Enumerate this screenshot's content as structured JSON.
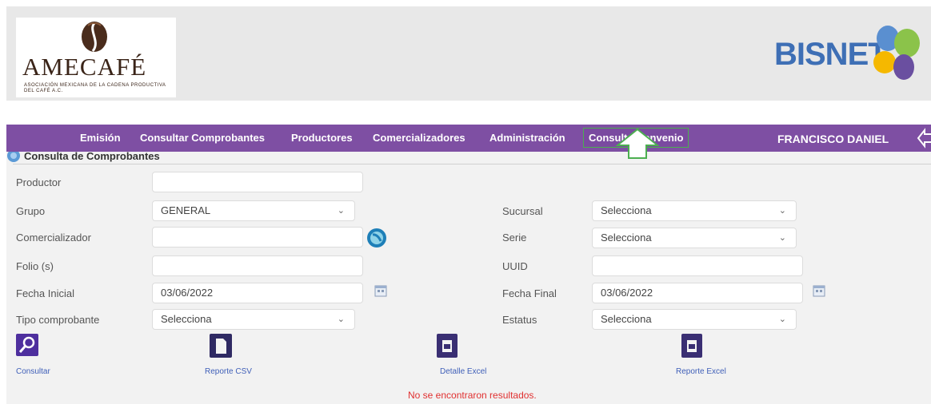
{
  "header": {
    "logo_text": "AMECAFÉ",
    "logo_sub": "ASOCIACIÓN MEXICANA DE LA CADENA PRODUCTIVA DEL CAFÉ A.C.",
    "brand": "BISNET"
  },
  "nav": {
    "items": [
      "Emisión",
      "Consultar Comprobantes",
      "Productores",
      "Comercializadores",
      "Administración",
      "Consulta Convenio"
    ],
    "user": "FRANCISCO DANIEL"
  },
  "panel": {
    "title": "Consulta de Comprobantes"
  },
  "form": {
    "productor": {
      "label": "Productor",
      "value": ""
    },
    "grupo": {
      "label": "Grupo",
      "value": "GENERAL"
    },
    "comercializador": {
      "label": "Comercializador",
      "value": ""
    },
    "folio": {
      "label": "Folio (s)",
      "value": ""
    },
    "fecha_inicial": {
      "label": "Fecha Inicial",
      "value": "03/06/2022"
    },
    "tipo": {
      "label": "Tipo comprobante",
      "value": "Selecciona"
    },
    "sucursal": {
      "label": "Sucursal",
      "value": "Selecciona"
    },
    "serie": {
      "label": "Serie",
      "value": "Selecciona"
    },
    "uuid": {
      "label": "UUID",
      "value": ""
    },
    "fecha_final": {
      "label": "Fecha Final",
      "value": "03/06/2022"
    },
    "estatus": {
      "label": "Estatus",
      "value": "Selecciona"
    }
  },
  "actions": {
    "consultar": "Consultar",
    "reporte_csv": "Reporte CSV",
    "detalle_excel": "Detalle Excel",
    "reporte_excel": "Reporte Excel"
  },
  "message": "No se encontraron resultados.",
  "colors": {
    "nav_bg": "#7e4fa3",
    "highlight": "#4caf50",
    "link": "#3f5fb8",
    "error": "#e03030"
  }
}
